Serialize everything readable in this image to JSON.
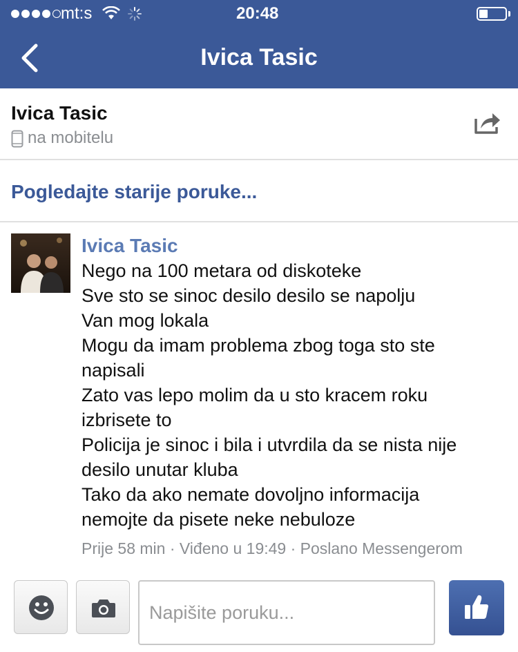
{
  "status_bar": {
    "carrier": "mt:s",
    "time": "20:48"
  },
  "nav": {
    "title": "Ivica Tasic"
  },
  "contact": {
    "name": "Ivica Tasic",
    "status": "na mobitelu"
  },
  "older_link": "Pogledajte starije poruke...",
  "message": {
    "sender": "Ivica Tasic",
    "lines": [
      "Nego na 100 metara od diskoteke",
      "Sve sto se sinoc desilo desilo se napolju",
      "Van mog lokala",
      "Mogu da imam problema zbog toga sto ste",
      "napisali",
      "Zato vas lepo molim da u sto kracem roku",
      "izbrisete to",
      "Policija je sinoc i bila i utvrdila da se nista nije",
      "desilo unutar kluba",
      "Tako da ako nemate dovoljno informacija",
      "nemojte da pisete neke nebuloze"
    ],
    "meta": "Prije 58 min · Viđeno u 19:49 · Poslano Messengerom"
  },
  "composer": {
    "placeholder": "Napišite poruku..."
  },
  "icons": {
    "back": "chevron-left-icon",
    "share": "share-icon",
    "emoji": "smiley-icon",
    "camera": "camera-icon",
    "like": "thumbs-up-icon",
    "phone": "mobile-phone-icon"
  },
  "colors": {
    "brand": "#3b5998",
    "sender": "#5b7bb4",
    "meta": "#8a8d91"
  }
}
